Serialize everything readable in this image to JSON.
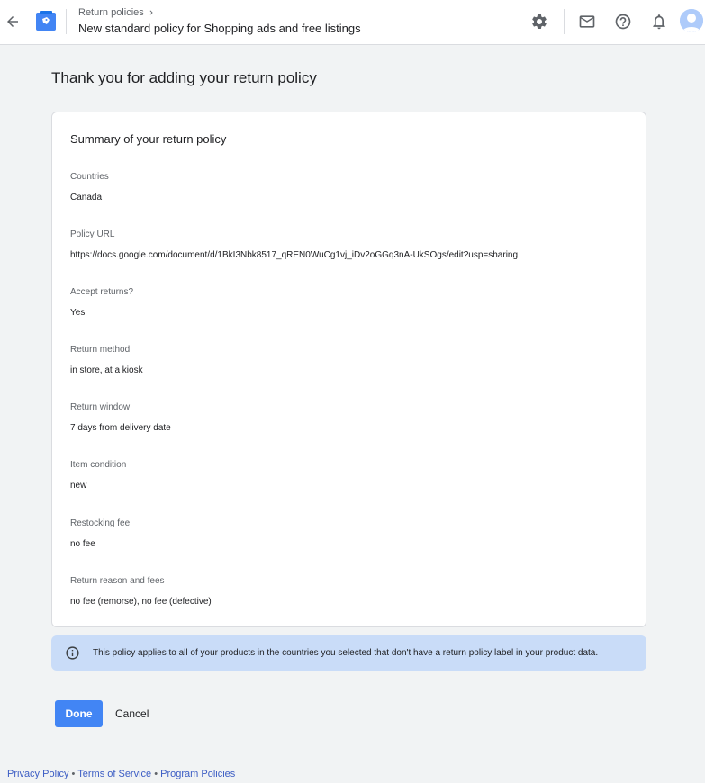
{
  "header": {
    "breadcrumb": "Return policies",
    "title": "New standard policy for Shopping ads and free listings",
    "icons": [
      "back-arrow-icon",
      "app-logo-icon",
      "chevron-right-icon",
      "gear-icon",
      "mail-icon",
      "help-icon",
      "bell-icon",
      "avatar"
    ]
  },
  "main": {
    "title": "Thank you for adding your return policy",
    "card_title": "Summary of your return policy",
    "fields": [
      {
        "label": "Countries",
        "value": "Canada"
      },
      {
        "label": "Policy URL",
        "value": "https://docs.google.com/document/d/1BkI3Nbk8517_qREN0WuCg1vj_iDv2oGGq3nA-UkSOgs/edit?usp=sharing"
      },
      {
        "label": "Accept returns?",
        "value": "Yes"
      },
      {
        "label": "Return method",
        "value": "in store, at a kiosk"
      },
      {
        "label": "Return window",
        "value": "7 days from delivery date"
      },
      {
        "label": "Item condition",
        "value": "new"
      },
      {
        "label": "Restocking fee",
        "value": "no fee"
      },
      {
        "label": "Return reason and fees",
        "value": "no fee (remorse), no fee (defective)"
      }
    ],
    "info_text": "This policy applies to all of your products in the countries you selected that don't have a return policy label in your product data."
  },
  "actions": {
    "done_label": "Done",
    "cancel_label": "Cancel"
  },
  "footer": {
    "privacy": "Privacy Policy",
    "terms": "Terms of Service",
    "program": "Program Policies",
    "separator": "•"
  },
  "colors": {
    "accent": "#4285f4",
    "info_bg": "#c9dcf8",
    "link": "#3c5dc4"
  }
}
